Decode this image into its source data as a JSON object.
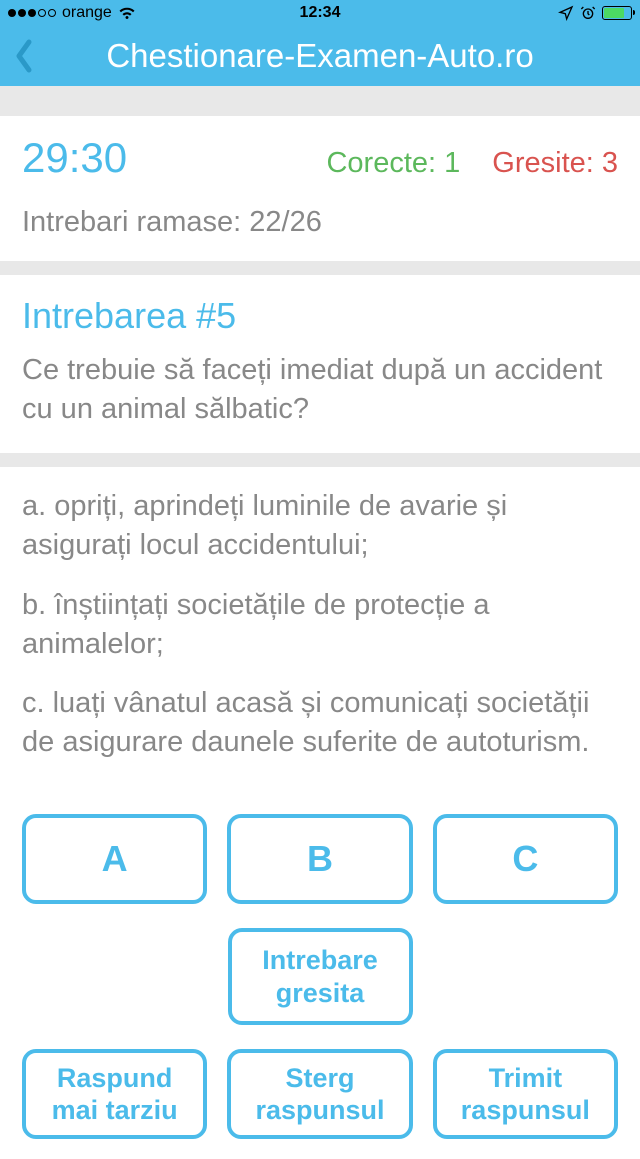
{
  "status_bar": {
    "carrier": "orange",
    "time": "12:34"
  },
  "header": {
    "title": "Chestionare-Examen-Auto.ro"
  },
  "quiz_status": {
    "timer": "29:30",
    "correct_label": "Corecte: 1",
    "wrong_label": "Gresite: 3",
    "remaining": "Intrebari ramase: 22/26"
  },
  "question": {
    "number": "Intrebarea #5",
    "text": "Ce trebuie să faceți imediat după un accident cu un animal sălbatic?"
  },
  "answers": {
    "a": "a. opriți, aprindeți luminile de avarie și asigurați locul accidentului;",
    "b": "b. înștiințați societățile de protecție a animalelor;",
    "c": "c. luați vânatul acasă și comunicați societății de asigurare daunele suferite de autoturism."
  },
  "buttons": {
    "choice_a": "A",
    "choice_b": "B",
    "choice_c": "C",
    "wrong_question": "Intrebare gresita",
    "answer_later": "Raspund mai tarziu",
    "clear_answer": "Sterg raspunsul",
    "submit_answer": "Trimit raspunsul"
  }
}
